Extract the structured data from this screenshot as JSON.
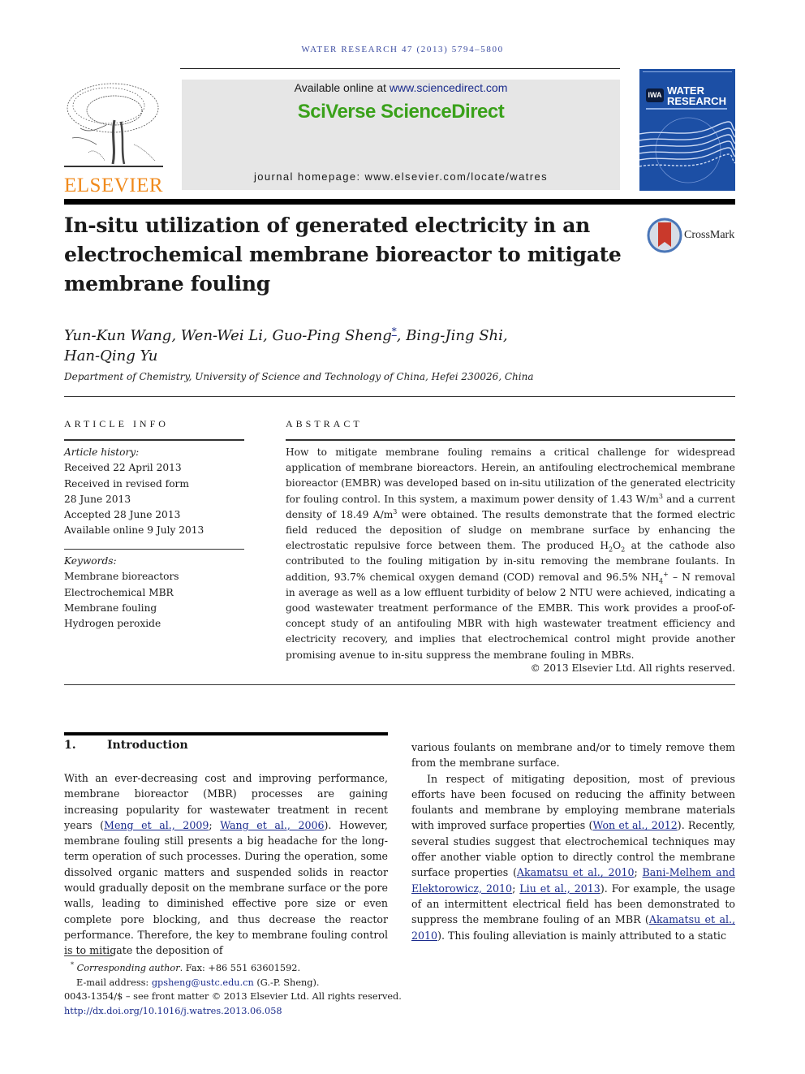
{
  "journal": {
    "running_head": "WATER RESEARCH 47 (2013) 5794–5800",
    "publisher_logo_text": "ELSEVIER",
    "available_online_prefix": "Available online at ",
    "available_online_link": "www.sciencedirect.com",
    "platform_brand": "SciVerse ScienceDirect",
    "homepage_label": "journal homepage: www.elsevier.com/locate/watres",
    "cover": {
      "title_line1": "WATER",
      "title_line2": "RESEARCH",
      "badge": "IWA"
    },
    "colors": {
      "elsevier_orange": "#f08a1c",
      "sciencedirect_green": "#3aa11a",
      "link_blue": "#1a2b8c",
      "cover_blue": "#1c4fa5"
    }
  },
  "article": {
    "title": "In-situ utilization of generated electricity in an electrochemical membrane bioreactor to mitigate membrane fouling",
    "title_lines": [
      "In-situ utilization of generated electricity in an",
      "electrochemical membrane bioreactor to mitigate",
      "membrane fouling"
    ],
    "crossmark_label": "CrossMark",
    "authors_line1_pre": "Yun-Kun Wang, Wen-Wei Li, Guo-Ping Sheng",
    "authors_star": "*",
    "authors_line1_post": ", Bing-Jing Shi,",
    "authors_line2": "Han-Qing Yu",
    "affiliation": "Department of Chemistry, University of Science and Technology of China, Hefei 230026, China"
  },
  "article_info": {
    "heading": "ARTICLE INFO",
    "history_label": "Article history:",
    "history": [
      "Received 22 April 2013",
      "Received in revised form",
      "28 June 2013",
      "Accepted 28 June 2013",
      "Available online 9 July 2013"
    ],
    "keywords_label": "Keywords:",
    "keywords": [
      "Membrane bioreactors",
      "Electrochemical MBR",
      "Membrane fouling",
      "Hydrogen peroxide"
    ]
  },
  "abstract": {
    "heading": "ABSTRACT",
    "p1": "How to mitigate membrane fouling remains a critical challenge for widespread application of membrane bioreactors. Herein, an antifouling electrochemical membrane bioreactor (EMBR) was developed based on in-situ utilization of the generated electricity for fouling control. In this system, a maximum power density of 1.43 W/m",
    "sup1": "3",
    "p2": " and a current density of 18.49 A/m",
    "sup2": "3",
    "p3": " were obtained. The results demonstrate that the formed electric field reduced the deposition of sludge on membrane surface by enhancing the electrostatic repulsive force between them. The produced H",
    "sub1": "2",
    "p4": "O",
    "sub2": "2",
    "p5": " at the cathode also contributed to the fouling mitigation by in-situ removing the membrane foulants. In addition, 93.7% chemical oxygen demand (COD) removal and 96.5% NH",
    "sub3": "4",
    "sup3": "+",
    "p6": " – N removal in average as well as a low effluent turbidity of below 2 NTU were achieved, indicating a good wastewater treatment performance of the EMBR. This work provides a proof-of-concept study of an antifouling MBR with high wastewater treatment efficiency and electricity recovery, and implies that electrochemical control might provide another promising avenue to in-situ suppress the membrane fouling in MBRs.",
    "copyright": "© 2013 Elsevier Ltd. All rights reserved."
  },
  "introduction": {
    "number": "1.",
    "heading": "Introduction",
    "left": {
      "t1": "With an ever-decreasing cost and improving performance, membrane bioreactor (MBR) processes are gaining increasing popularity for wastewater treatment in recent years (",
      "c1": "Meng et al., 2009",
      "t2": "; ",
      "c2": "Wang et al., 2006",
      "t3": "). However, membrane fouling still presents a big headache for the long-term operation of such processes. During the operation, some dissolved organic matters and suspended solids in reactor would gradually deposit on the membrane surface or the pore walls, leading to diminished effective pore size or even complete pore blocking, and thus decrease the reactor performance. Therefore, the key to membrane fouling control is to mitigate the deposition of"
    },
    "right": {
      "p1": "various foulants on membrane and/or to timely remove them from the membrane surface.",
      "t1": "In respect of mitigating deposition, most of previous efforts have been focused on reducing the affinity between foulants and membrane by employing membrane materials with improved surface properties (",
      "c1": "Won et al., 2012",
      "t2": "). Recently, several studies suggest that electrochemical techniques may offer another viable option to directly control the membrane surface properties (",
      "c2": "Akamatsu et al., 2010",
      "t3": "; ",
      "c3": "Bani-Melhem and Elektorowicz, 2010",
      "t4": "; ",
      "c4": "Liu et al., 2013",
      "t5": "). For example, the usage of an intermittent electrical field has been demonstrated to suppress the membrane fouling of an MBR (",
      "c5": "Akamatsu et al., 2010",
      "t6": "). This fouling alleviation is mainly attributed to a static"
    }
  },
  "footnotes": {
    "star": "*",
    "corresponding_label": "Corresponding author",
    "fax": ". Fax: +86 551 63601592.",
    "email_label": "E-mail address: ",
    "email": "gpsheng@ustc.edu.cn",
    "email_suffix": " (G.-P. Sheng).",
    "issn_line": "0043-1354/$ – see front matter © 2013 Elsevier Ltd. All rights reserved.",
    "doi": "http://dx.doi.org/10.1016/j.watres.2013.06.058"
  }
}
